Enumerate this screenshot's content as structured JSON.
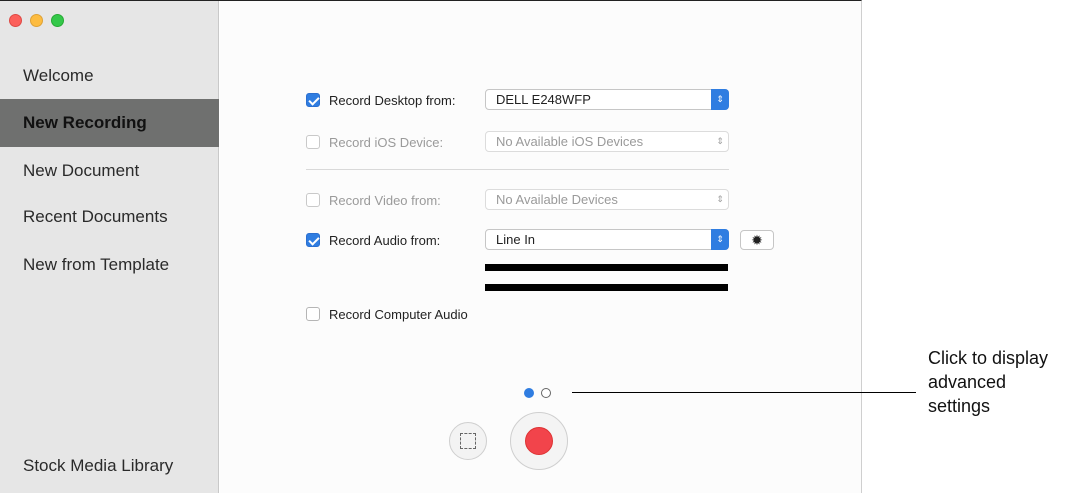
{
  "sidebar": {
    "items": [
      {
        "label": "Welcome"
      },
      {
        "label": "New Recording",
        "active": true
      },
      {
        "label": "New Document"
      },
      {
        "label": "Recent Documents"
      },
      {
        "label": "New from Template"
      }
    ],
    "footer_item": "Stock Media Library"
  },
  "recording": {
    "desktop": {
      "label": "Record Desktop from:",
      "checked": true,
      "value": "DELL E248WFP"
    },
    "ios": {
      "label": "Record iOS Device:",
      "checked": false,
      "value": "No Available iOS Devices"
    },
    "video": {
      "label": "Record Video from:",
      "checked": false,
      "value": "No Available Devices"
    },
    "audio": {
      "label": "Record Audio from:",
      "checked": true,
      "value": "Line In"
    },
    "computer_audio": {
      "label": "Record Computer Audio",
      "checked": false
    }
  },
  "page_indicator": {
    "pages": 2,
    "current": 1
  },
  "callout": {
    "lines": [
      "Click to display",
      "advanced",
      "settings"
    ]
  },
  "colors": {
    "accent": "#2f7de1",
    "record": "#f2444b",
    "sidebar_selected": "#6f706f"
  },
  "icons": [
    "gear-icon",
    "selection-icon",
    "record-icon",
    "stepper-arrows-icon",
    "checkmark-icon"
  ]
}
